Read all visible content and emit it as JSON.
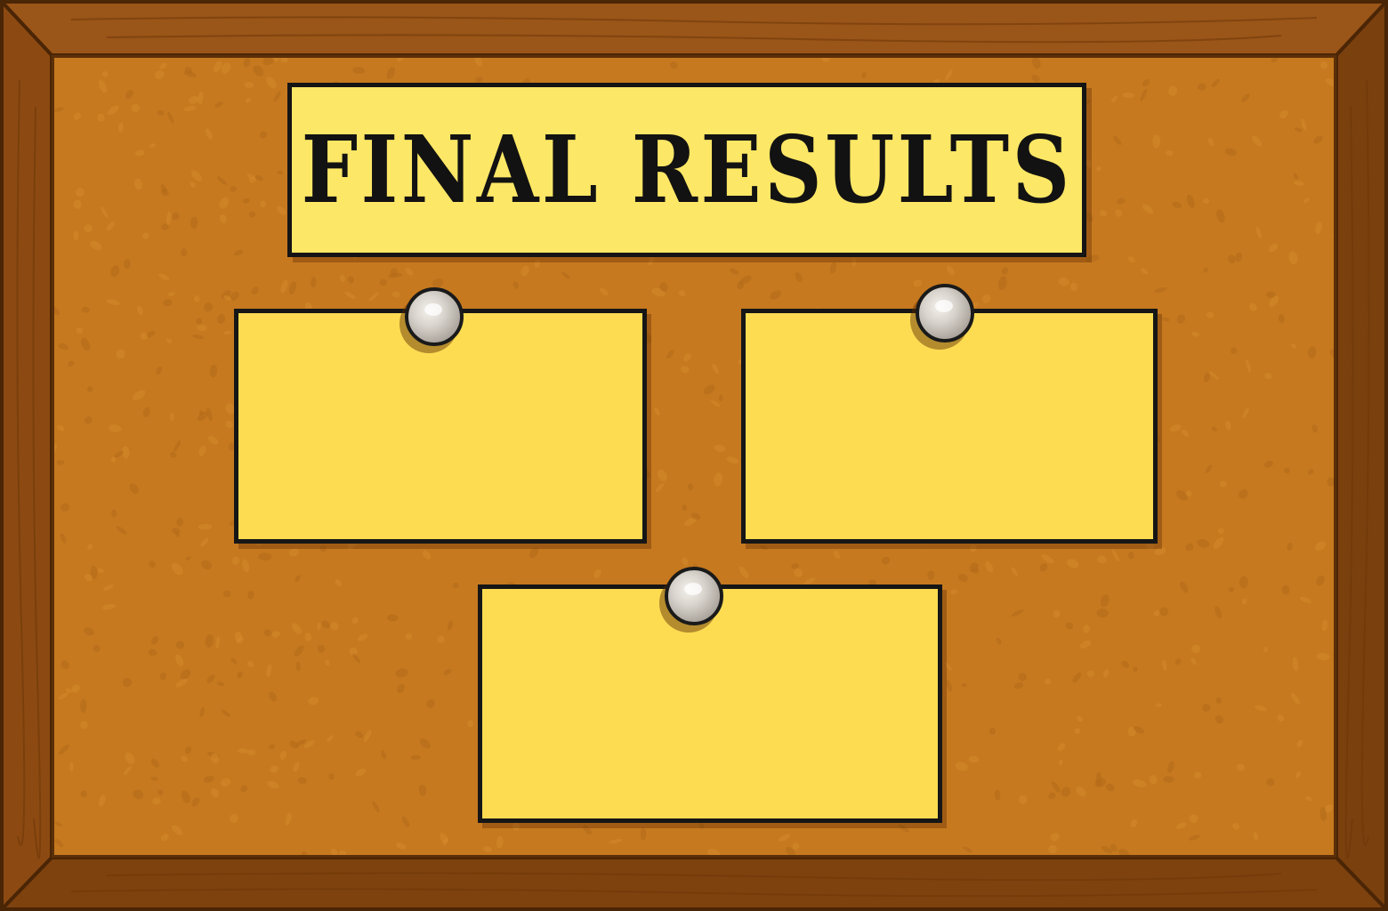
{
  "board": {
    "title": "FINAL RESULTS"
  },
  "notes": [
    {
      "content": ""
    },
    {
      "content": ""
    },
    {
      "content": ""
    }
  ],
  "colors": {
    "frame_wood": "#8a4a12",
    "cork": "#c6791f",
    "sign_fill": "#fde766",
    "note_fill": "#fddc52",
    "outline": "#151515",
    "pin": "#cfcac3"
  },
  "icons": {
    "pushpin": "pushpin-icon"
  }
}
